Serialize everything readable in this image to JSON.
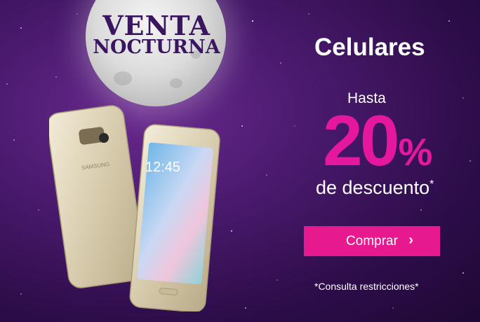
{
  "brand": {
    "line1": "VENTA",
    "line2": "NOCTURNA"
  },
  "promo": {
    "category": "Celulares",
    "prefix": "Hasta",
    "discount_value": "20",
    "discount_symbol": "%",
    "suffix": "de descuento",
    "suffix_mark": "*"
  },
  "cta": {
    "label": "Comprar",
    "icon": "chevron-right-icon"
  },
  "legal": {
    "text": "*Consulta restricciones*"
  },
  "phone_screen": {
    "time": "12:45"
  },
  "phone_back": {
    "brand": "SAMSUNG"
  },
  "colors": {
    "background": "#4a1a6e",
    "accent": "#e5179e",
    "button": "#e6198f",
    "text": "#ffffff"
  }
}
